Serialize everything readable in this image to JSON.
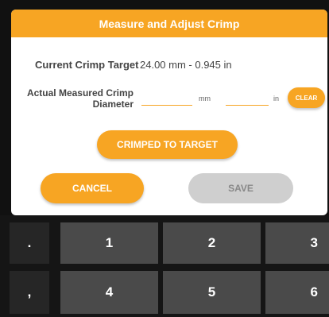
{
  "dialog": {
    "title": "Measure and Adjust Crimp",
    "current_label": "Current Crimp Target",
    "current_value": "24.00 mm  -  0.945 in",
    "measured_label_line1": "Actual Measured Crimp",
    "measured_label_line2": "Diameter",
    "mm_field_value": "",
    "mm_unit": "mm",
    "in_field_value": "",
    "in_unit": "in",
    "clear_label": "CLEAR",
    "crimped_label": "CRIMPED TO TARGET",
    "cancel_label": "CANCEL",
    "save_label": "SAVE"
  },
  "keyboard": {
    "keys": [
      ".",
      "1",
      "2",
      "3",
      ",",
      "4",
      "5",
      "6"
    ]
  },
  "colors": {
    "accent": "#f7a523",
    "disabled": "#cfcfcf",
    "key": "#4a4a4a",
    "keyboard_bg": "#151515"
  }
}
